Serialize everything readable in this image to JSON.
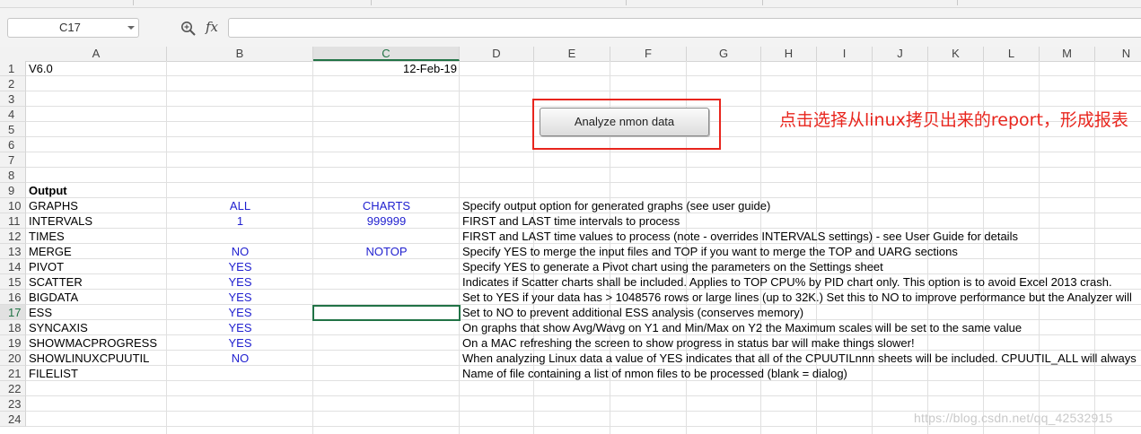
{
  "formula_bar": {
    "name_box": "C17",
    "fx_label": "fx",
    "formula": ""
  },
  "columns": [
    "A",
    "B",
    "C",
    "D",
    "E",
    "F",
    "G",
    "H",
    "I",
    "J",
    "K",
    "L",
    "M",
    "N"
  ],
  "selected_column": "C",
  "rows": [
    "1",
    "2",
    "3",
    "4",
    "5",
    "6",
    "7",
    "8",
    "9",
    "10",
    "11",
    "12",
    "13",
    "14",
    "15",
    "16",
    "17",
    "18",
    "19",
    "20",
    "21",
    "22",
    "23",
    "24"
  ],
  "selected_row": "17",
  "cells": {
    "A1": "V6.0",
    "C1": "12-Feb-19",
    "A9": "Output",
    "A10": "GRAPHS",
    "B10": "ALL",
    "C10": "CHARTS",
    "D10": "Specify output option for generated graphs (see user guide)",
    "A11": "INTERVALS",
    "B11": "1",
    "C11": "999999",
    "D11": "FIRST and LAST time intervals to process",
    "A12": "TIMES",
    "D12": "FIRST and LAST time values to process (note - overrides INTERVALS settings) - see User Guide for details",
    "A13": "MERGE",
    "B13": "NO",
    "C13": "NOTOP",
    "D13": "Specify YES to merge the input files and TOP if you want to merge the TOP and UARG sections",
    "A14": "PIVOT",
    "B14": "YES",
    "D14": "Specify YES to generate a Pivot chart using the parameters on the Settings sheet",
    "A15": "SCATTER",
    "B15": "YES",
    "D15": "Indicates if Scatter charts shall be included.  Applies to TOP CPU% by PID chart only.  This option is to avoid Excel 2013 crash.",
    "A16": "BIGDATA",
    "B16": "YES",
    "D16": "Set to YES if your data has > 1048576 rows or large lines (up to 32K.)  Set this to NO to improve performance but the Analyzer will",
    "A17": "ESS",
    "B17": "YES",
    "D17": "Set to NO to prevent additional ESS analysis (conserves memory)",
    "A18": "SYNCAXIS",
    "B18": "YES",
    "D18": "On graphs that show Avg/Wavg on Y1 and Min/Max on Y2 the Maximum scales will be set to the same value",
    "A19": "SHOWMACPROGRESS",
    "B19": "YES",
    "D19": "On a MAC refreshing the screen to show progress in status bar will make things slower!",
    "A20": "SHOWLINUXCPUUTIL",
    "B20": "NO",
    "D20": "When analyzing Linux data a value of YES indicates that all of the CPUUTILnnn sheets will be included.  CPUUTIL_ALL will always",
    "A21": "FILELIST",
    "D21": "Name of file containing a list of nmon files to be processed (blank = dialog)"
  },
  "button": {
    "label": "Analyze nmon data"
  },
  "annotation": "点击选择从linux拷贝出来的report，形成报表",
  "watermark": "https://blog.csdn.net/qq_42532915",
  "colors": {
    "accent_green": "#217346",
    "value_blue": "#1f1fcf",
    "annotation_red": "#e8251d"
  }
}
